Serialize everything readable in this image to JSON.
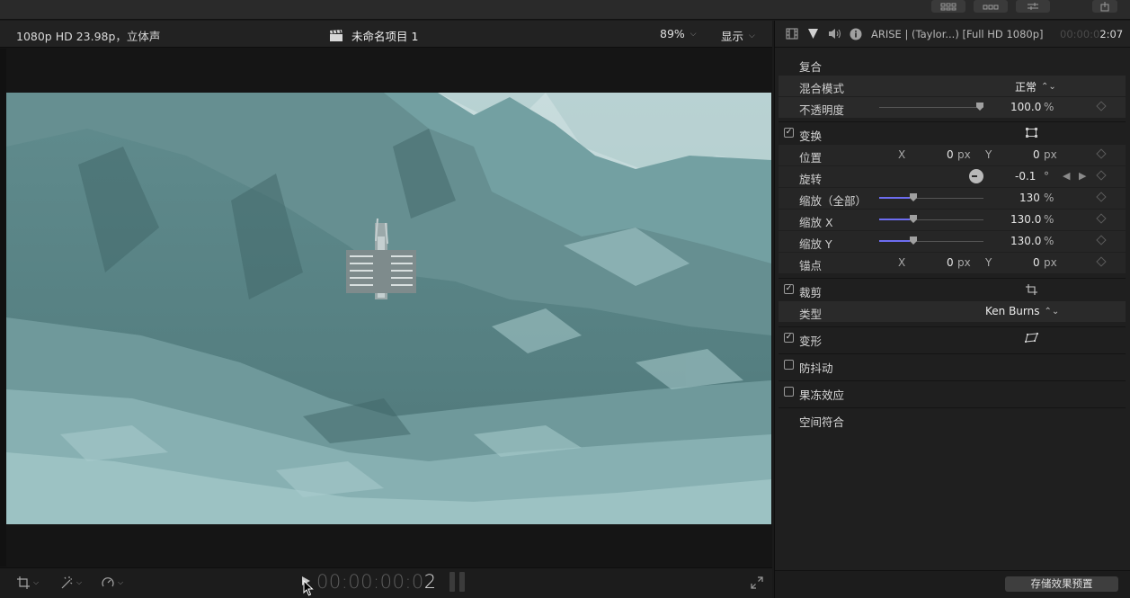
{
  "viewer": {
    "format": "1080p HD 23.98p，立体声",
    "project_title": "未命名项目 1",
    "zoom": "89%",
    "display_label": "显示",
    "timecode_dim": "00:00:00:0",
    "timecode_last": "2"
  },
  "inspector": {
    "clip_name": "ARISE | (Taylor...) [Full HD 1080p]",
    "time_dim": "00:00:0",
    "time_bright": "2:07",
    "compositing": {
      "title": "复合",
      "blend_mode_label": "混合模式",
      "blend_mode_value": "正常",
      "opacity_label": "不透明度",
      "opacity_value": "100.0",
      "opacity_unit": "%",
      "opacity_fraction": 1.0
    },
    "transform": {
      "title": "变换",
      "enabled": true,
      "position_label": "位置",
      "x_axis": "X",
      "y_axis": "Y",
      "position_x": "0",
      "position_y": "0",
      "px_unit": "px",
      "rotation_label": "旋转",
      "rotation_value": "-0.1",
      "rotation_unit": "°",
      "scale_all_label": "缩放（全部）",
      "scale_all_value": "130",
      "scale_x_label": "缩放 X",
      "scale_x_value": "130.0",
      "scale_y_label": "缩放 Y",
      "scale_y_value": "130.0",
      "percent_unit": "%",
      "anchor_label": "锚点",
      "anchor_x": "0",
      "anchor_y": "0"
    },
    "crop": {
      "title": "裁剪",
      "enabled": true,
      "type_label": "类型",
      "type_value": "Ken Burns"
    },
    "distort": {
      "title": "变形",
      "enabled": true
    },
    "stabilization": {
      "title": "防抖动",
      "enabled": false
    },
    "rolling_shutter": {
      "title": "果冻效应",
      "enabled": false
    },
    "spatial_conform": {
      "title": "空间符合"
    },
    "save_preset": "存储效果预置"
  },
  "icons": [
    "grid-view-icon",
    "filmstrip-view-icon",
    "adjust-sliders-icon",
    "share-icon",
    "clapper-icon",
    "video-inspector-icon",
    "color-inspector-icon",
    "audio-inspector-icon",
    "info-inspector-icon",
    "transform-overlay-icon",
    "crop-overlay-icon",
    "distort-overlay-icon",
    "crop-tool-icon",
    "enhance-wand-icon",
    "retime-speed-icon",
    "fullscreen-icon",
    "play-icon",
    "mouse-cursor-icon"
  ],
  "colors": {
    "slider_fill": "#6d6df0",
    "background": "#1f1f1f"
  }
}
